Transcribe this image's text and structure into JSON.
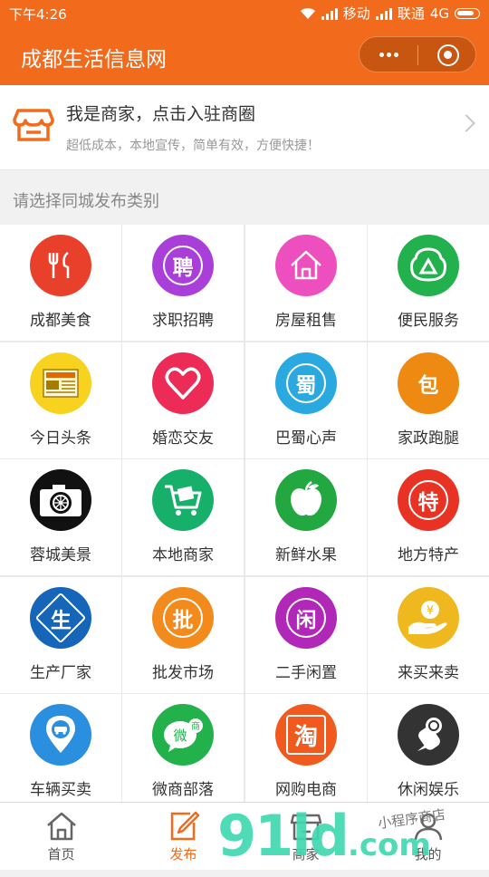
{
  "status": {
    "time": "下午4:26",
    "carrier1": "移动",
    "carrier2": "联通",
    "network": "4G"
  },
  "header": {
    "title": "成都生活信息网"
  },
  "merchant": {
    "title": "我是商家，点击入驻商圈",
    "subtitle": "超低成本，本地宣传，简单有效，方便快捷！"
  },
  "section_label": "请选择同城发布类别",
  "categories": [
    {
      "label": "成都美食",
      "icon": "food-icon",
      "color": "#e8402b",
      "glyph": ""
    },
    {
      "label": "求职招聘",
      "icon": "recruit-icon",
      "color": "#a93fd8",
      "glyph": "聘"
    },
    {
      "label": "房屋租售",
      "icon": "house-icon",
      "color": "#ee4fbf",
      "glyph": ""
    },
    {
      "label": "便民服务",
      "icon": "service-icon",
      "color": "#22b14c",
      "glyph": ""
    },
    {
      "label": "今日头条",
      "icon": "news-icon",
      "color": "#f7d21f",
      "glyph": ""
    },
    {
      "label": "婚恋交友",
      "icon": "heart-icon",
      "color": "#ec2b56",
      "glyph": ""
    },
    {
      "label": "巴蜀心声",
      "icon": "shu-icon",
      "color": "#2aa8e0",
      "glyph": "蜀"
    },
    {
      "label": "家政跑腿",
      "icon": "housekeeping-icon",
      "color": "#ee8a12",
      "glyph": "包"
    },
    {
      "label": "蓉城美景",
      "icon": "camera-icon",
      "color": "#111111",
      "glyph": ""
    },
    {
      "label": "本地商家",
      "icon": "cart-icon",
      "color": "#17b06a",
      "glyph": ""
    },
    {
      "label": "新鲜水果",
      "icon": "apple-icon",
      "color": "#23a740",
      "glyph": ""
    },
    {
      "label": "地方特产",
      "icon": "specialty-icon",
      "color": "#e83223",
      "glyph": "特"
    },
    {
      "label": "生产厂家",
      "icon": "factory-icon",
      "color": "#1565b8",
      "glyph": "生"
    },
    {
      "label": "批发市场",
      "icon": "wholesale-icon",
      "color": "#f28a1c",
      "glyph": "批"
    },
    {
      "label": "二手闲置",
      "icon": "secondhand-icon",
      "color": "#b127b8",
      "glyph": "闲"
    },
    {
      "label": "来买来卖",
      "icon": "trade-icon",
      "color": "#f0b81f",
      "glyph": ""
    },
    {
      "label": "车辆买卖",
      "icon": "car-icon",
      "color": "#2b8fe0",
      "glyph": ""
    },
    {
      "label": "微商部落",
      "icon": "wechat-shop-icon",
      "color": "#23b14c",
      "glyph": ""
    },
    {
      "label": "网购电商",
      "icon": "taobao-icon",
      "color": "#f05a1e",
      "glyph": "淘"
    },
    {
      "label": "休闲娱乐",
      "icon": "mic-icon",
      "color": "#333333",
      "glyph": ""
    }
  ],
  "tabs": [
    {
      "label": "首页",
      "icon": "home-icon"
    },
    {
      "label": "发布",
      "icon": "publish-icon"
    },
    {
      "label": "商家",
      "icon": "shop-icon"
    },
    {
      "label": "我的",
      "icon": "user-icon"
    }
  ],
  "watermark": {
    "big": "91ld",
    "big_suffix": ".com",
    "small": "小程序商店"
  },
  "colors": {
    "brand": "#f26b1d"
  }
}
